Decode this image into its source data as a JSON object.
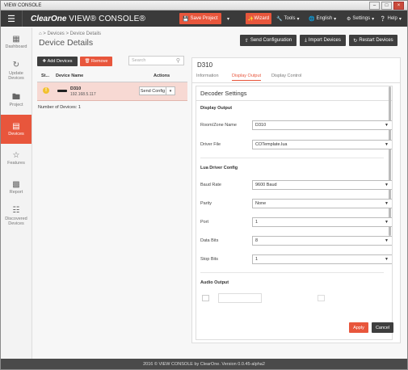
{
  "window": {
    "title": "VIEW CONSOLE"
  },
  "nav": {
    "logo": "ClearOne",
    "app_name": "VIEW® CONSOLE®",
    "save_project": "Save Project",
    "wizard": "Wizard",
    "tools": "Tools",
    "language": "English",
    "settings": "Settings",
    "help": "Help"
  },
  "sidebar": {
    "items": [
      {
        "label": "Dashboard",
        "icon": "dashboard-icon",
        "active": false
      },
      {
        "label": "Update Devices",
        "icon": "refresh-icon",
        "active": false
      },
      {
        "label": "Project",
        "icon": "folder-icon",
        "active": false
      },
      {
        "label": "Devices",
        "icon": "hdd-icon",
        "active": true
      },
      {
        "label": "Features",
        "icon": "star-icon",
        "active": false
      },
      {
        "label": "Report",
        "icon": "bar-chart-icon",
        "active": false
      },
      {
        "label": "Discovered Devices",
        "icon": "grid-icon",
        "active": false
      }
    ]
  },
  "breadcrumb": {
    "home": "⌂",
    "items": [
      "Devices",
      "Device Details"
    ]
  },
  "page_title": "Device Details",
  "toolbar": {
    "send_configuration": "Send Configuration",
    "import_devices": "Import Devices",
    "restart_devices": "Restart Devices"
  },
  "devices": {
    "add_label": "Add Devices",
    "remove_label": "Remove",
    "search_placeholder": "Search",
    "columns": [
      "St...",
      "Device Name",
      "Actions"
    ],
    "rows": [
      {
        "status": "!",
        "name": "D310",
        "ip": "192.168.5.117",
        "action": "Send Config"
      }
    ],
    "count_label": "Number of Devices: 1"
  },
  "detail": {
    "title": "D310",
    "tabs": [
      "Information",
      "Display Output",
      "Display Control"
    ],
    "active_tab": "Display Output",
    "settings_title": "Decoder Settings",
    "display_output": {
      "section": "Display Output",
      "room_zone_label": "Room/Zone Name",
      "room_zone_value": "D310",
      "driver_file_label": "Driver File",
      "driver_file_value": "COTemplate.lua"
    },
    "lua": {
      "section": "Lua Driver Config",
      "baud_label": "Baud Rate",
      "baud_value": "9600 Baud",
      "parity_label": "Parity",
      "parity_value": "None",
      "port_label": "Port",
      "port_value": "1",
      "data_bits_label": "Data Bits",
      "data_bits_value": "8",
      "stop_bits_label": "Stop Bits",
      "stop_bits_value": "1"
    },
    "audio": {
      "section": "Audio Output"
    },
    "apply_label": "Apply",
    "cancel_label": "Cancel"
  },
  "footer": {
    "text": "2016 © VIEW CONSOLE by ClearOne. Version 0.0.45-alpha2"
  },
  "colors": {
    "accent": "#e8563c",
    "nav_bg": "#3a3a3a",
    "selected_row": "#f7d9d3",
    "warning": "#f2c12e"
  }
}
